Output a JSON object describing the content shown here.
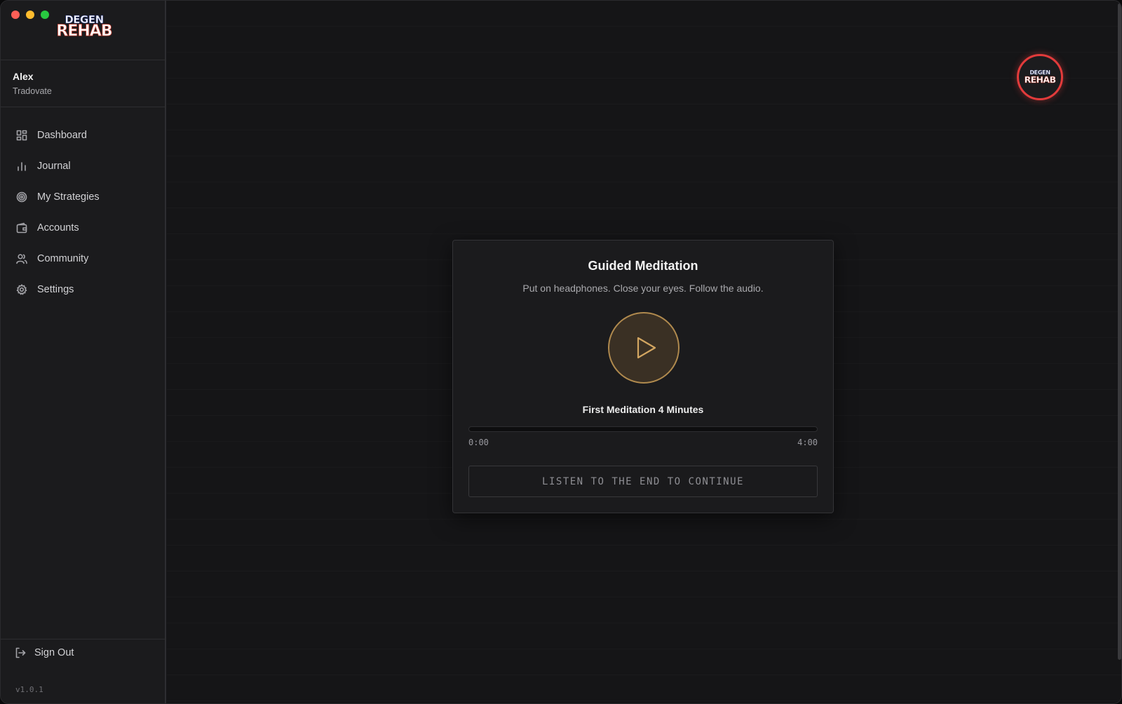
{
  "app": {
    "logo_top": "DEGEN",
    "logo_bottom": "REHAB",
    "version": "v1.0.1"
  },
  "user": {
    "name": "Alex",
    "broker": "Tradovate"
  },
  "sidebar": {
    "items": [
      {
        "label": "Dashboard",
        "icon": "dashboard-grid-icon"
      },
      {
        "label": "Journal",
        "icon": "bar-chart-icon"
      },
      {
        "label": "My Strategies",
        "icon": "target-icon"
      },
      {
        "label": "Accounts",
        "icon": "wallet-icon"
      },
      {
        "label": "Community",
        "icon": "users-icon"
      },
      {
        "label": "Settings",
        "icon": "gear-icon"
      }
    ],
    "sign_out_label": "Sign Out"
  },
  "badge": {
    "top": "DEGEN",
    "bottom": "REHAB"
  },
  "meditation": {
    "title": "Guided Meditation",
    "subtitle": "Put on headphones. Close your eyes. Follow the audio.",
    "track_title": "First Meditation 4 Minutes",
    "progress": 0,
    "time_current": "0:00",
    "time_total": "4:00",
    "continue_label": "LISTEN TO THE END TO CONTINUE"
  },
  "colors": {
    "accent": "#d3a661",
    "badge_ring": "#e23b3b"
  }
}
